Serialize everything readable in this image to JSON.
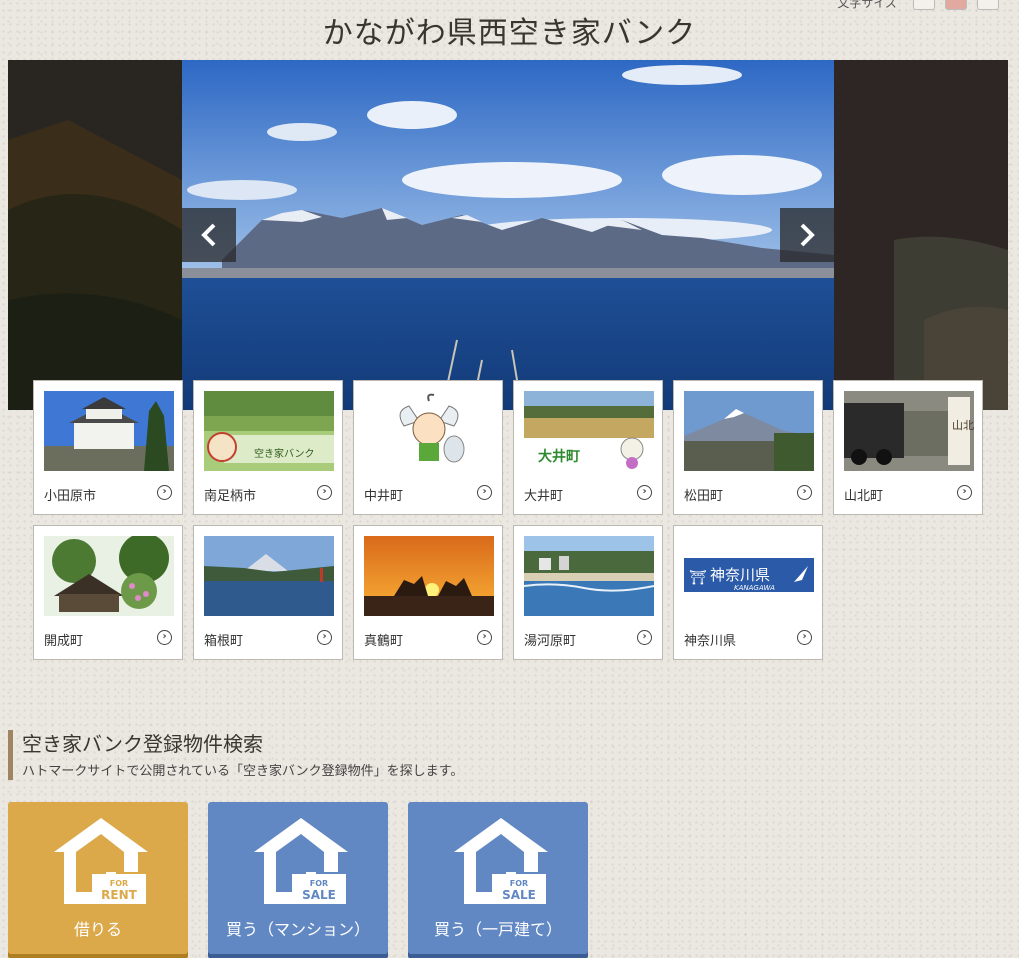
{
  "header": {
    "title": "かながわ県西空き家バンク",
    "fontsize_label": "文字サイズ"
  },
  "slider": {
    "prev_icon": "chevron-left-icon",
    "next_icon": "chevron-right-icon"
  },
  "municipalities": [
    {
      "label": "小田原市",
      "thumb": "castle"
    },
    {
      "label": "南足柄市",
      "thumb": "field-logo"
    },
    {
      "label": "中井町",
      "thumb": "mascot"
    },
    {
      "label": "大井町",
      "thumb": "rice-field"
    },
    {
      "label": "松田町",
      "thumb": "fuji-town"
    },
    {
      "label": "山北町",
      "thumb": "steam-train"
    },
    {
      "label": "開成町",
      "thumb": "garden-house"
    },
    {
      "label": "箱根町",
      "thumb": "lake-fuji"
    },
    {
      "label": "真鶴町",
      "thumb": "sunset-rocks"
    },
    {
      "label": "湯河原町",
      "thumb": "beach"
    },
    {
      "label": "神奈川県",
      "thumb": "prefecture-logo"
    }
  ],
  "thumb_text": {
    "minamiashigara": "空き家バンク",
    "oi": "大井町",
    "yamakita": "山北町",
    "kanagawa_jp": "神奈川県",
    "kanagawa_en": "KANAGAWA"
  },
  "search": {
    "title": "空き家バンク登録物件検索",
    "description": "ハトマークサイトで公開されている「空き家バンク登録物件」を探します。",
    "buttons": [
      {
        "label": "借りる",
        "badge_top": "FOR",
        "badge_bottom": "RENT",
        "color": "#dca94a"
      },
      {
        "label": "買う（マンション）",
        "badge_top": "FOR",
        "badge_bottom": "SALE",
        "color": "#6288c4"
      },
      {
        "label": "買う（一戸建て）",
        "badge_top": "FOR",
        "badge_bottom": "SALE",
        "color": "#6288c4"
      }
    ]
  }
}
